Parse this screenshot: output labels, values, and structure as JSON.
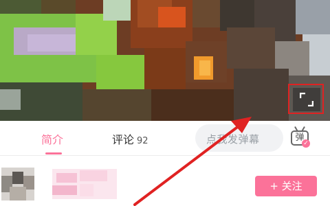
{
  "video": {
    "fullscreen_button": {
      "icon": "fullscreen-icon",
      "highlight_color": "#e02222"
    }
  },
  "tabs": [
    {
      "label": "简介",
      "active": true
    },
    {
      "label": "评论",
      "count": "92",
      "active": false
    }
  ],
  "danmaku": {
    "input_placeholder": "点我发弹幕",
    "toggle_label": "弹",
    "toggle_icon": "danmaku-toggle-icon"
  },
  "uploader": {
    "follow_label": "+ 关注"
  },
  "colors": {
    "accent": "#fb7299",
    "annotation": "#e02222"
  }
}
